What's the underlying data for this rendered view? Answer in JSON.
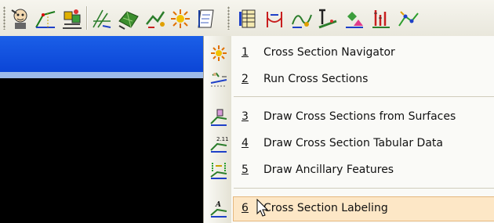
{
  "toolbar": {
    "icons": [
      "survey-man-icon",
      "slope-icon",
      "grading-icon",
      "alignment-icon",
      "surface-icon",
      "profile-icon",
      "cross-section-star-icon",
      "notebook-icon",
      "spreadsheet-icon",
      "intersection-icon",
      "trace-icon",
      "elevation-label-icon",
      "stakeout-icon",
      "pipe-icon",
      "network-icon"
    ]
  },
  "menu": {
    "items": [
      {
        "num": "1",
        "label": "Cross Section Navigator",
        "icon": "navigator-star-icon"
      },
      {
        "num": "2",
        "label": "Run Cross Sections",
        "icon": "run-cross-sections-icon"
      },
      {
        "num": "3",
        "label": "Draw Cross Sections from Surfaces",
        "icon": "draw-from-surfaces-icon"
      },
      {
        "num": "4",
        "label": "Draw Cross Section Tabular Data",
        "icon": "tabular-data-icon"
      },
      {
        "num": "5",
        "label": "Draw Ancillary Features",
        "icon": "ancillary-features-icon"
      },
      {
        "num": "6",
        "label": "Cross Section Labeling",
        "icon": "labeling-icon"
      }
    ],
    "highlighted_index": 5,
    "icon_badges": {
      "tabular": "2.11",
      "labeling": "A"
    }
  },
  "colors": {
    "title_bar": "#0b45d6",
    "viewport": "#000000",
    "highlight": "#fde7c6"
  }
}
